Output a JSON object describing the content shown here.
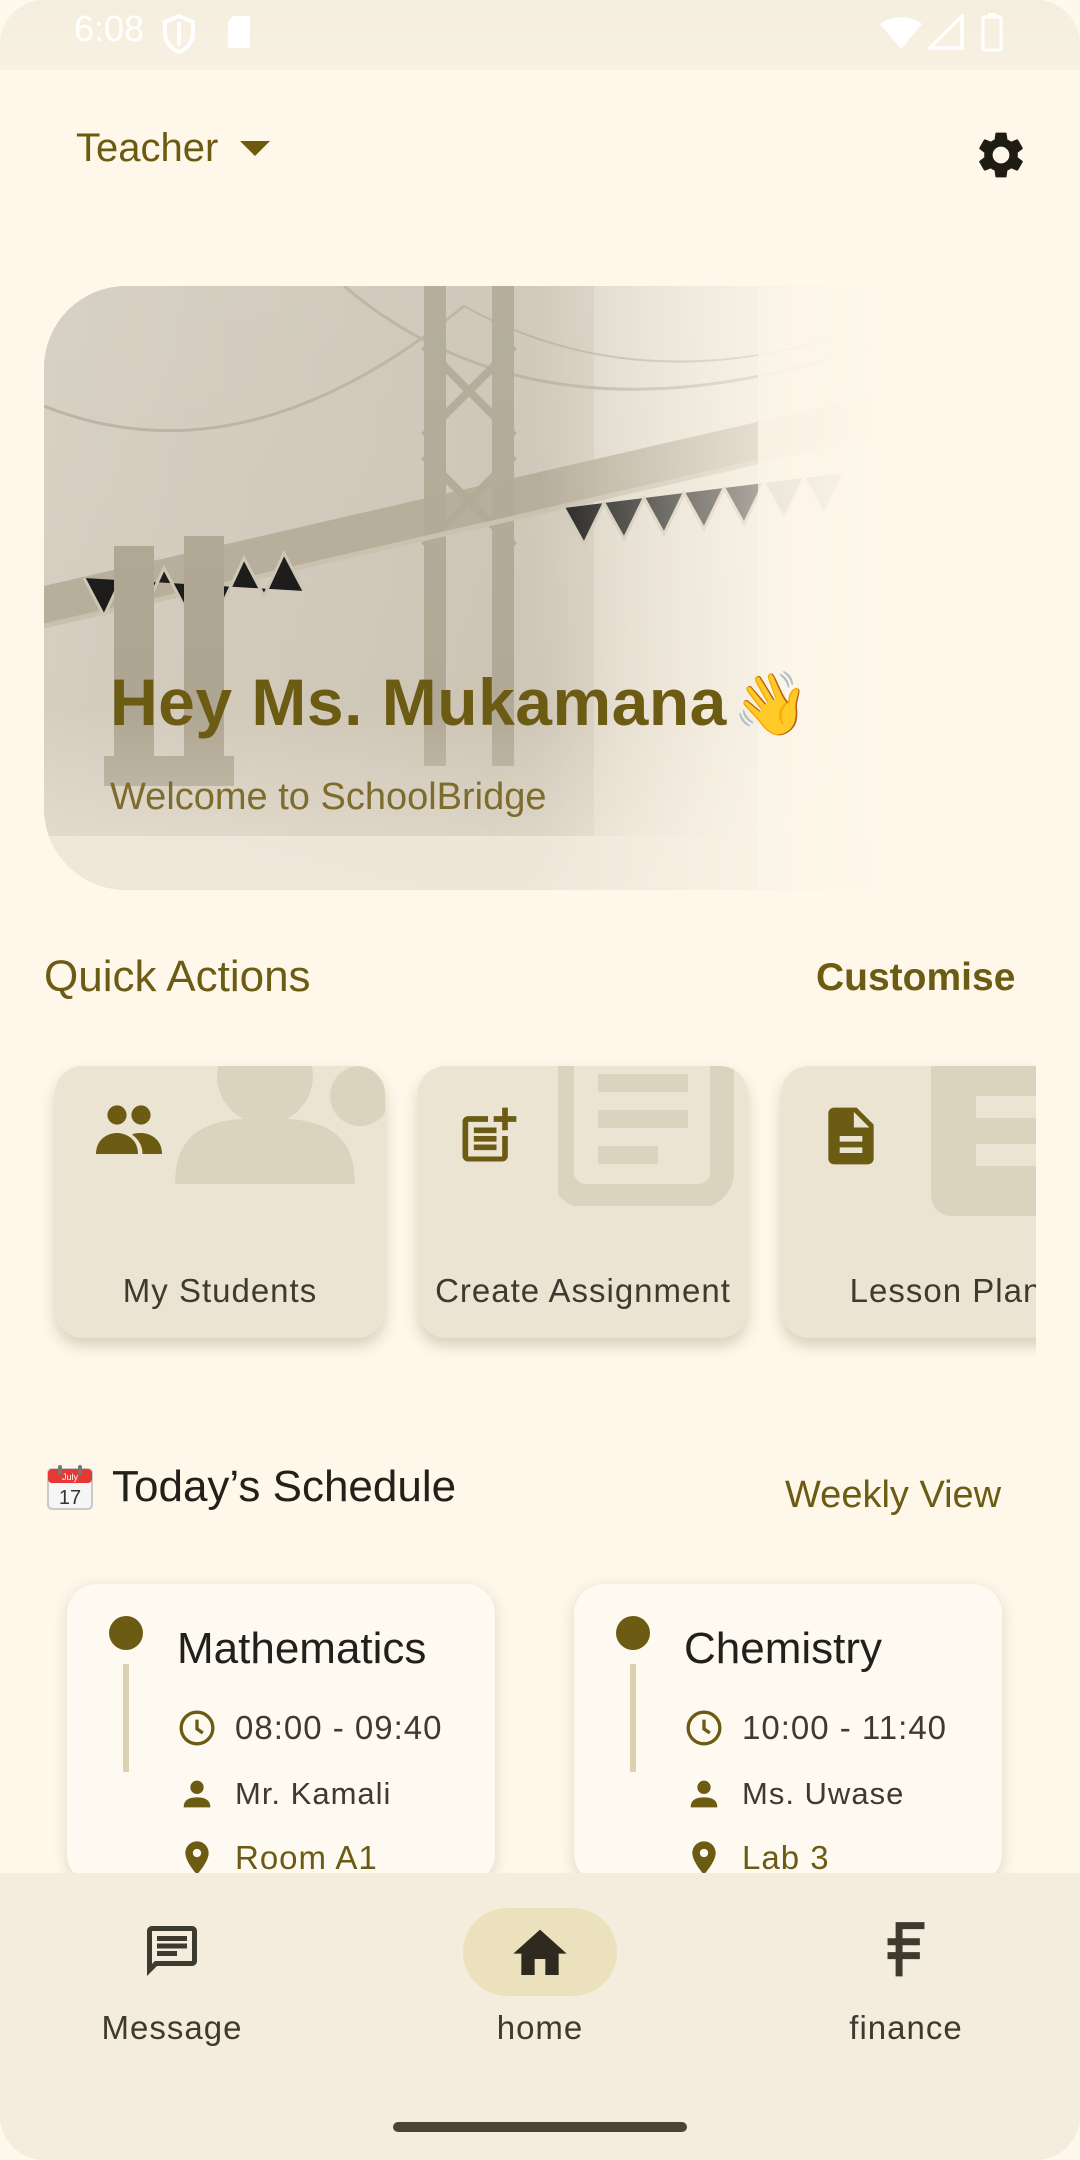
{
  "status_bar": {
    "time": "6:08"
  },
  "app_bar": {
    "role": "Teacher"
  },
  "hero": {
    "title": "Hey Ms. Mukamana",
    "emoji": "👋",
    "subtitle": "Welcome to SchoolBridge"
  },
  "quick_actions": {
    "title": "Quick Actions",
    "customise_label": "Customise",
    "items": [
      {
        "label": "My Students",
        "icon": "group-icon"
      },
      {
        "label": "Create Assignment",
        "icon": "post-add-icon"
      },
      {
        "label": "Lesson Plan",
        "icon": "description-icon"
      }
    ]
  },
  "schedule": {
    "title": "Today’s Schedule",
    "weekly_view_label": "Weekly View",
    "calendar_month": "July",
    "calendar_day": "17",
    "items": [
      {
        "subject": "Mathematics",
        "time": "08:00 - 09:40",
        "teacher": "Mr. Kamali",
        "location": "Room A1"
      },
      {
        "subject": "Chemistry",
        "time": "10:00 - 11:40",
        "teacher": "Ms. Uwase",
        "location": "Lab 3"
      }
    ]
  },
  "bottom_nav": {
    "items": [
      {
        "label": "Message",
        "icon": "message-icon"
      },
      {
        "label": "home",
        "icon": "home-icon",
        "selected": true
      },
      {
        "label": "finance",
        "icon": "currency-icon"
      }
    ]
  },
  "colors": {
    "accent": "#6b5b13",
    "background": "#fef7ea",
    "card": "#ece4d2",
    "nav_selected": "#ece1bd"
  }
}
